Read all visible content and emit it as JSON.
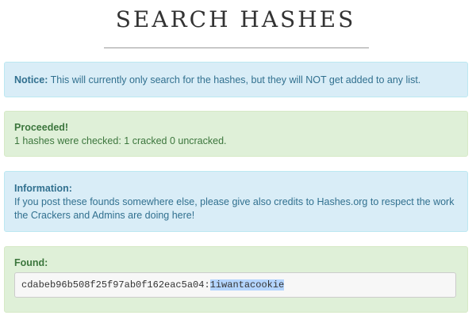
{
  "page": {
    "title": "SEARCH HASHES"
  },
  "notice": {
    "label": "Notice:",
    "text": " This will currently only search for the hashes, but they will NOT get added to any list."
  },
  "proceeded": {
    "label": "Proceeded!",
    "text": "1 hashes were checked: 1 cracked 0 uncracked."
  },
  "information": {
    "label": "Information:",
    "text": "If you post these founds somewhere else, please give also credits to Hashes.org to respect the work the Crackers and Admins are doing here!"
  },
  "found": {
    "label": "Found:",
    "hash_prefix": "cdabeb96b508f25f97ab0f162eac5a04:",
    "plaintext": "1iwantacookie"
  },
  "colors": {
    "info_background": "#d9edf7",
    "info_text": "#31708f",
    "success_background": "#dff0d8",
    "success_text": "#3c763d",
    "selection_highlight": "#b4d5fe"
  }
}
